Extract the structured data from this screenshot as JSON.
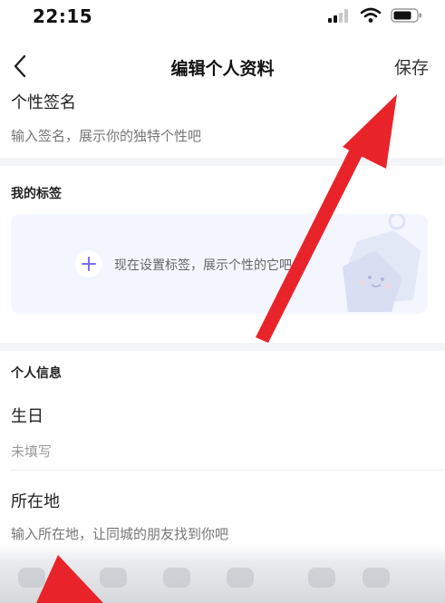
{
  "status_bar": {
    "time": "22:15"
  },
  "nav": {
    "title": "编辑个人资料",
    "save_label": "保存"
  },
  "signature": {
    "label": "个性签名",
    "placeholder": "输入签名，展示你的独特个性吧"
  },
  "tags": {
    "section_title": "我的标签",
    "prompt": "现在设置标签，展示个性的它吧"
  },
  "personal_info": {
    "section_title": "个人信息",
    "birthday": {
      "label": "生日",
      "value": "未填写"
    },
    "location": {
      "label": "所在地",
      "placeholder": "输入所在地，让同城的朋友找到你吧"
    }
  },
  "colors": {
    "arrow": "#e8242a",
    "tag_card_bg": "#f3f6fd",
    "plus_accent": "#7b6cf6"
  }
}
